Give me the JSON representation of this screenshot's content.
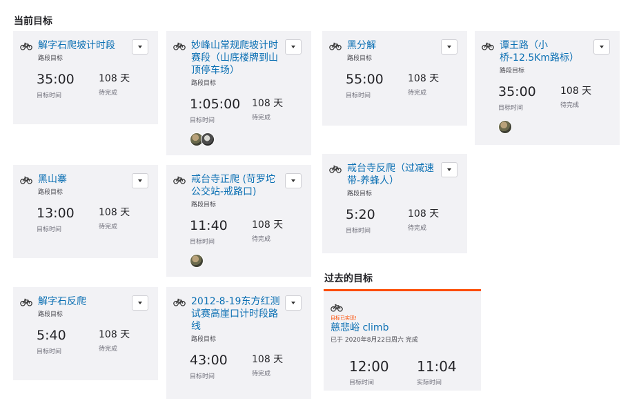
{
  "sections": {
    "current": "当前目标",
    "past": "过去的目标"
  },
  "common": {
    "goal_type": "路段目标",
    "target_time_label": "目标时间",
    "pending_label": "待完成",
    "actual_time_label": "实际时间"
  },
  "goals": [
    {
      "title": "解字石爬坡计时段",
      "target": "35:00",
      "days": "108 天"
    },
    {
      "title": "妙峰山常规爬坡计时赛段（山底楼牌到山顶停车场）",
      "target": "1:05:00",
      "days": "108 天"
    },
    {
      "title": "黑分解",
      "target": "55:00",
      "days": "108 天"
    },
    {
      "title": "谭王路（小桥-12.5Km路标）",
      "target": "35:00",
      "days": "108 天"
    },
    {
      "title": "黑山寨",
      "target": "13:00",
      "days": "108 天"
    },
    {
      "title": "戒台寺正爬 (苛罗坨公交站-戒路口)",
      "target": "11:40",
      "days": "108 天"
    },
    {
      "title": "戒台寺反爬（过减速带-养蜂人）",
      "target": "5:20",
      "days": "108 天"
    },
    {
      "title": "解字石反爬",
      "target": "5:40",
      "days": "108 天"
    },
    {
      "title": "2012-8-19东方红测试赛高崖口计时段路线",
      "target": "43:00",
      "days": "108 天"
    }
  ],
  "past_goal": {
    "achieved": "目标已实现!",
    "title": "慈悲峪 climb",
    "date": "已于 2020年8月22日周六 完成",
    "target": "12:00",
    "actual": "11:04"
  },
  "icons": {
    "bike": "bicycle-icon",
    "menu": "chevron-down-icon",
    "avatar": "avatar"
  },
  "colors": {
    "link": "#0a6fb3",
    "accent": "#fc4c02",
    "card_bg": "#f2f2f5"
  }
}
